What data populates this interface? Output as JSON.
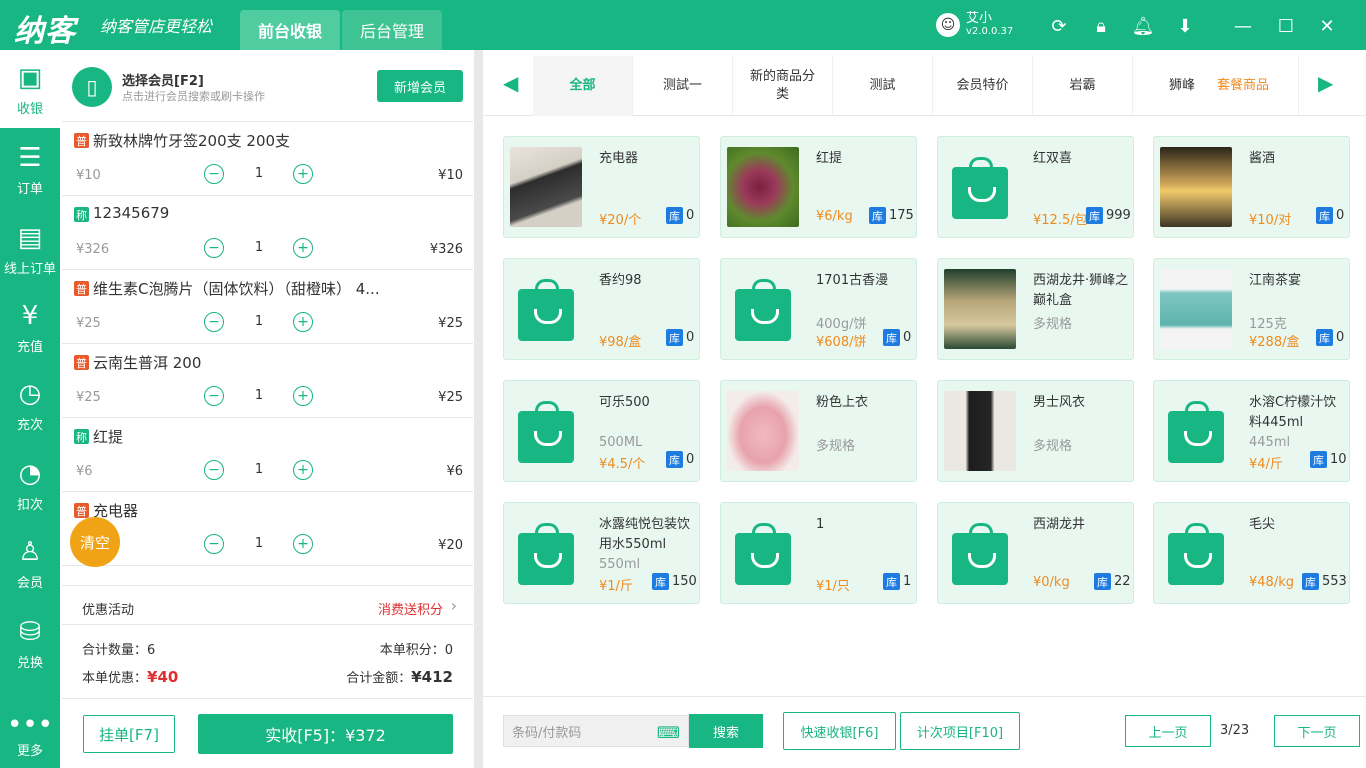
{
  "header": {
    "logo": "纳客",
    "slogan": "纳客管店更轻松",
    "tabs": [
      {
        "label": "前台收银",
        "active": true
      },
      {
        "label": "后台管理",
        "active": false
      }
    ],
    "user": {
      "name": "艾小",
      "version": "v2.0.0.37"
    }
  },
  "sidebar": {
    "items": [
      {
        "label": "收银",
        "icon": "cashier-icon",
        "active": true
      },
      {
        "label": "订单",
        "icon": "order-icon"
      },
      {
        "label": "线上订单",
        "icon": "online-order-icon"
      },
      {
        "label": "充值",
        "icon": "recharge-icon"
      },
      {
        "label": "充次",
        "icon": "recharge-times-icon"
      },
      {
        "label": "扣次",
        "icon": "deduct-times-icon"
      },
      {
        "label": "会员",
        "icon": "member-icon"
      },
      {
        "label": "兑换",
        "icon": "exchange-icon"
      },
      {
        "label": "更多",
        "icon": "more-icon"
      }
    ]
  },
  "member": {
    "title": "选择会员[F2]",
    "subtitle": "点击进行会员搜索或刷卡操作",
    "new_button": "新增会员"
  },
  "cart": {
    "items": [
      {
        "tag": "普",
        "name": "新致林牌竹牙签200支 200支",
        "price": "¥10",
        "qty": "1",
        "total": "¥10"
      },
      {
        "tag": "称",
        "name": "12345679",
        "price": "¥326",
        "qty": "1",
        "total": "¥326"
      },
      {
        "tag": "普",
        "name": "维生素C泡腾片（固体饮料）（甜橙味） 4...",
        "price": "¥25",
        "qty": "1",
        "total": "¥25"
      },
      {
        "tag": "普",
        "name": "云南生普洱 200",
        "price": "¥25",
        "qty": "1",
        "total": "¥25"
      },
      {
        "tag": "称",
        "name": "红提",
        "price": "¥6",
        "qty": "1",
        "total": "¥6"
      },
      {
        "tag": "普",
        "name": "充电器",
        "price": "",
        "qty": "1",
        "total": "¥20"
      }
    ],
    "clear_button": "清空",
    "promo_label": "优惠活动",
    "promo_value": "消费送积分",
    "total_qty_label": "合计数量：6",
    "points_label": "本单积分：0",
    "discount_label": "本单优惠：",
    "discount_value": "¥40",
    "total_amount_label": "合计金额：",
    "total_amount_value": "¥412",
    "hold_button": "挂单[F7]",
    "pay_button": "实收[F5]：¥372"
  },
  "categories": {
    "items": [
      "全部",
      "测試一",
      "新的商品分类",
      "测試",
      "会员特价",
      "岩霸",
      "狮峰"
    ],
    "extra": "套餐商品",
    "active": "全部"
  },
  "products": [
    {
      "name": "充电器",
      "sub": "",
      "price": "¥20/个",
      "stock": "0",
      "img": "photo-charger"
    },
    {
      "name": "红提",
      "sub": "",
      "price": "¥6/kg",
      "stock": "175",
      "img": "photo-grapes"
    },
    {
      "name": "红双喜",
      "sub": "",
      "price": "¥12.5/包",
      "stock": "999",
      "img": "bag"
    },
    {
      "name": "酱酒",
      "sub": "",
      "price": "¥10/对",
      "stock": "0",
      "img": "photo-store"
    },
    {
      "name": "香约98",
      "sub": "",
      "price": "¥98/盒",
      "stock": "0",
      "img": "bag"
    },
    {
      "name": "1701古香漫",
      "sub": "400g/饼",
      "price": "¥608/饼",
      "stock": "0",
      "img": "bag"
    },
    {
      "name": "西湖龙井·狮峰之巅礼盒",
      "sub": "多规格",
      "price": "",
      "stock": "",
      "img": "photo-tea"
    },
    {
      "name": "江南茶宴",
      "sub": "125克",
      "price": "¥288/盒",
      "stock": "0",
      "img": "photo-box"
    },
    {
      "name": "可乐500",
      "sub": "500ML",
      "price": "¥4.5/个",
      "stock": "0",
      "img": "bag"
    },
    {
      "name": "粉色上衣",
      "sub": "多规格",
      "price": "",
      "stock": "",
      "img": "photo-shirt"
    },
    {
      "name": "男士风衣",
      "sub": "多规格",
      "price": "",
      "stock": "",
      "img": "photo-coat"
    },
    {
      "name": "水溶C柠檬汁饮料445ml",
      "sub": "445ml",
      "price": "¥4/斤",
      "stock": "10",
      "img": "bag"
    },
    {
      "name": "冰露纯悦包装饮用水550ml",
      "sub": "550ml",
      "price": "¥1/斤",
      "stock": "150",
      "img": "bag"
    },
    {
      "name": "1",
      "sub": "",
      "price": "¥1/只",
      "stock": "1",
      "img": "bag"
    },
    {
      "name": "西湖龙井",
      "sub": "",
      "price": "¥0/kg",
      "stock": "22",
      "img": "bag"
    },
    {
      "name": "毛尖",
      "sub": "",
      "price": "¥48/kg",
      "stock": "553",
      "img": "bag"
    }
  ],
  "stock_tag": "库",
  "bottom": {
    "scan_placeholder": "条码/付款码",
    "search_button": "搜索",
    "quick_button": "快速收银[F6]",
    "count_button": "计次项目[F10]",
    "prev_button": "上一页",
    "page": "3/23",
    "next_button": "下一页"
  }
}
